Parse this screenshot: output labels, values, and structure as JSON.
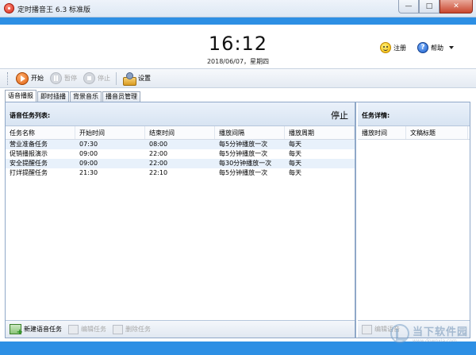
{
  "window": {
    "title": "定时播音王 6.3 标准版",
    "min_label": "—",
    "max_label": "□",
    "close_label": "✕"
  },
  "clock": {
    "time": "16:12",
    "date": "2018/06/07，星期四"
  },
  "top_actions": {
    "register_label": "注册",
    "help_label": "帮助"
  },
  "toolbar": {
    "start_label": "开始",
    "pause_label": "暂停",
    "stop_label": "停止",
    "settings_label": "设置"
  },
  "tabs": [
    "语音播报",
    "即时插播",
    "背景音乐",
    "播音员管理"
  ],
  "task_list": {
    "title": "语音任务列表:",
    "status": "停止",
    "columns": [
      "任务名称",
      "开始时间",
      "结束时间",
      "播放间隔",
      "播放周期"
    ],
    "rows": [
      [
        "营业准备任务",
        "07:30",
        "08:00",
        "每5分钟播放一次",
        "每天"
      ],
      [
        "促销播报演示",
        "09:00",
        "22:00",
        "每5分钟播放一次",
        "每天"
      ],
      [
        "安全提醒任务",
        "09:00",
        "22:00",
        "每30分钟播放一次",
        "每天"
      ],
      [
        "打烊提醒任务",
        "21:30",
        "22:10",
        "每5分钟播放一次",
        "每天"
      ]
    ],
    "new_label": "新建语音任务",
    "edit_label": "编辑任务",
    "delete_label": "删除任务"
  },
  "task_detail": {
    "title": "任务详情:",
    "columns": [
      "播放时间",
      "文稿标题"
    ],
    "edit_label": "编辑语音"
  },
  "watermark": {
    "main": "当下软件园",
    "sub": "www.downxia.com"
  }
}
